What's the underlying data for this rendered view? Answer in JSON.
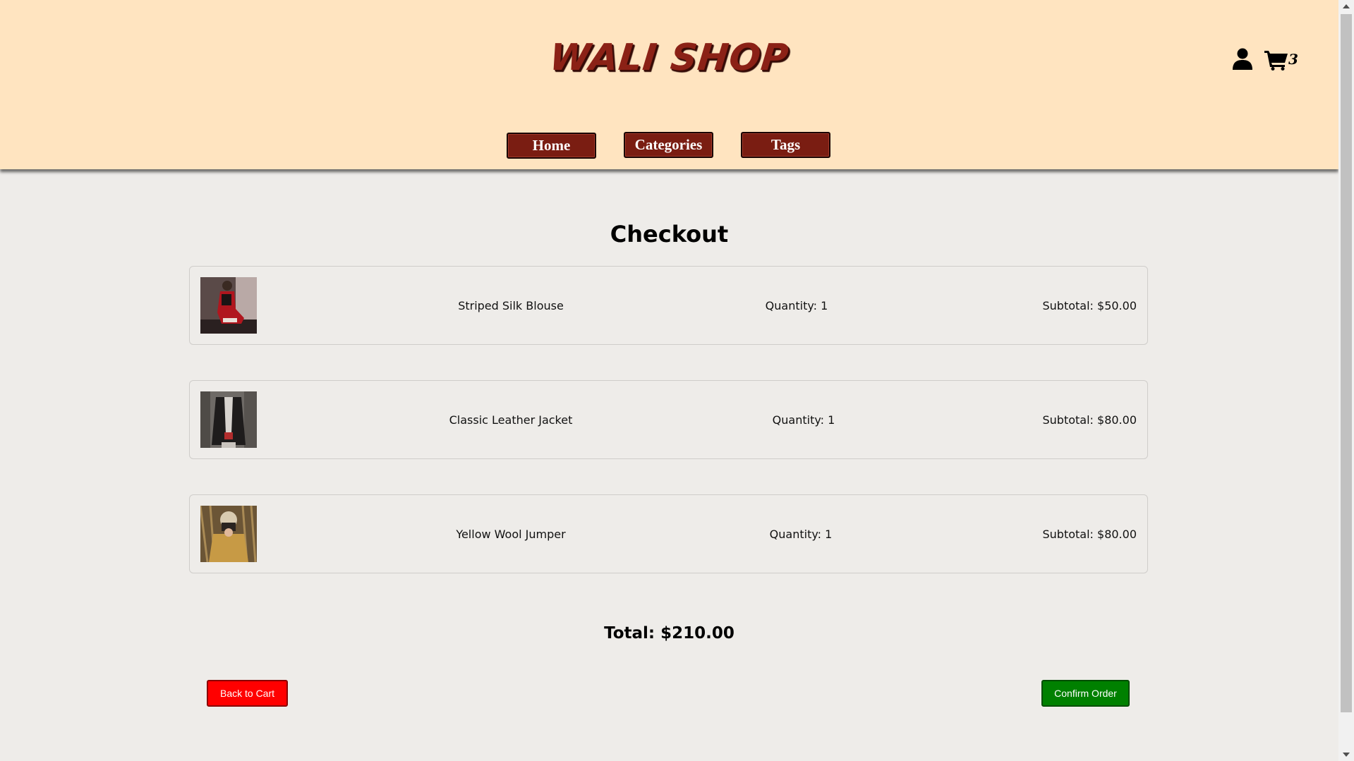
{
  "header": {
    "logo": "WALI SHOP",
    "user_icon": "user-icon",
    "cart_icon": "shopping-cart-icon",
    "cart_count": "3",
    "nav": [
      {
        "label": "Home"
      },
      {
        "label": "Categories"
      },
      {
        "label": "Tags"
      }
    ]
  },
  "checkout": {
    "title": "Checkout",
    "items": [
      {
        "name": "Striped Silk Blouse",
        "quantity": "Quantity: 1",
        "subtotal": "Subtotal: $50.00"
      },
      {
        "name": "Classic Leather Jacket",
        "quantity": "Quantity: 1",
        "subtotal": "Subtotal: $80.00"
      },
      {
        "name": "Yellow Wool Jumper",
        "quantity": "Quantity: 1",
        "subtotal": "Subtotal: $80.00"
      }
    ],
    "total": "Total: $210.00",
    "back_label": "Back to Cart",
    "confirm_label": "Confirm Order"
  },
  "colors": {
    "header_bg": "#ffe4c0",
    "nav_bg": "#7a1d12",
    "back_button": "#ff0000",
    "confirm_button": "#008000",
    "page_bg": "#eeece9"
  }
}
